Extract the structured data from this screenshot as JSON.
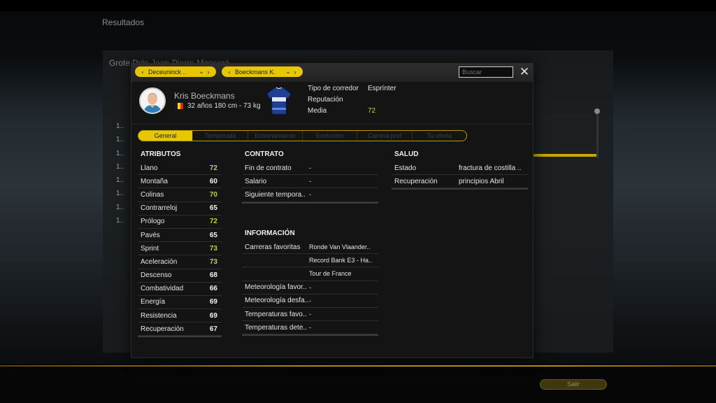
{
  "background": {
    "title": "Resultados",
    "panel_title": "Grote Prijs Jean-Pierre Monseré",
    "rank_rows": [
      "1..",
      "1..",
      "1..",
      "1..",
      "1..",
      "1..",
      "1..",
      "1.."
    ],
    "exit_label": "Salir"
  },
  "header": {
    "team_selector": "Deceuninck ..",
    "rider_selector": "Boeckmans K.",
    "search_placeholder": "Buscar",
    "close_icon": "close-icon"
  },
  "rider": {
    "name": "Kris Boeckmans",
    "nationality_flag_colors": [
      "#1a1a1a",
      "#f2d400",
      "#e0252c"
    ],
    "info": "32 años  180 cm - 73 kg",
    "meta": [
      {
        "key": "Tipo de corredor",
        "value": "Esprínter"
      },
      {
        "key": "Reputación",
        "value": ""
      },
      {
        "key": "Media",
        "value": "72"
      }
    ]
  },
  "tabs": [
    "General",
    "Temporada",
    "Entrenamiento",
    "Evolución",
    "Carrera prof",
    "Tu oferta"
  ],
  "atributos": {
    "title": "ATRIBUTOS",
    "items": [
      {
        "label": "Llano",
        "value": "72",
        "highlight": true
      },
      {
        "label": "Montaña",
        "value": "60",
        "highlight": false
      },
      {
        "label": "Colinas",
        "value": "70",
        "highlight": true
      },
      {
        "label": "Contrarreloj",
        "value": "65",
        "highlight": false
      },
      {
        "label": "Prólogo",
        "value": "72",
        "highlight": true
      },
      {
        "label": "Pavés",
        "value": "65",
        "highlight": false
      },
      {
        "label": "Sprint",
        "value": "73",
        "highlight": true
      },
      {
        "label": "Aceleración",
        "value": "73",
        "highlight": true
      },
      {
        "label": "Descenso",
        "value": "68",
        "highlight": false
      },
      {
        "label": "Combatividad",
        "value": "66",
        "highlight": false
      },
      {
        "label": "Energía",
        "value": "69",
        "highlight": false
      },
      {
        "label": "Resistencia",
        "value": "69",
        "highlight": false
      },
      {
        "label": "Recuperación",
        "value": "67",
        "highlight": false
      }
    ]
  },
  "contrato": {
    "title": "CONTRATO",
    "items": [
      {
        "label": "Fin de contrato",
        "value": "-"
      },
      {
        "label": "Salario",
        "value": "-"
      },
      {
        "label": "Siguiente tempora..",
        "value": "-"
      }
    ]
  },
  "informacion": {
    "title": "INFORMACIÓN",
    "items": [
      {
        "label": "Carreras favoritas",
        "value": "Ronde Van Vlaander.."
      },
      {
        "label": "",
        "value": "Record Bank E3 - Ha.."
      },
      {
        "label": "",
        "value": "Tour de France"
      },
      {
        "label": "Meteorología favor..",
        "value": "-"
      },
      {
        "label": "Meteorología desfa..",
        "value": "-"
      },
      {
        "label": "Temperaturas favo..",
        "value": "-"
      },
      {
        "label": "Temperaturas dete..",
        "value": "-"
      }
    ]
  },
  "salud": {
    "title": "SALUD",
    "items": [
      {
        "label": "Estado",
        "value": "fractura de costilla .."
      },
      {
        "label": "Recuperación",
        "value": "principios Abril"
      }
    ]
  }
}
